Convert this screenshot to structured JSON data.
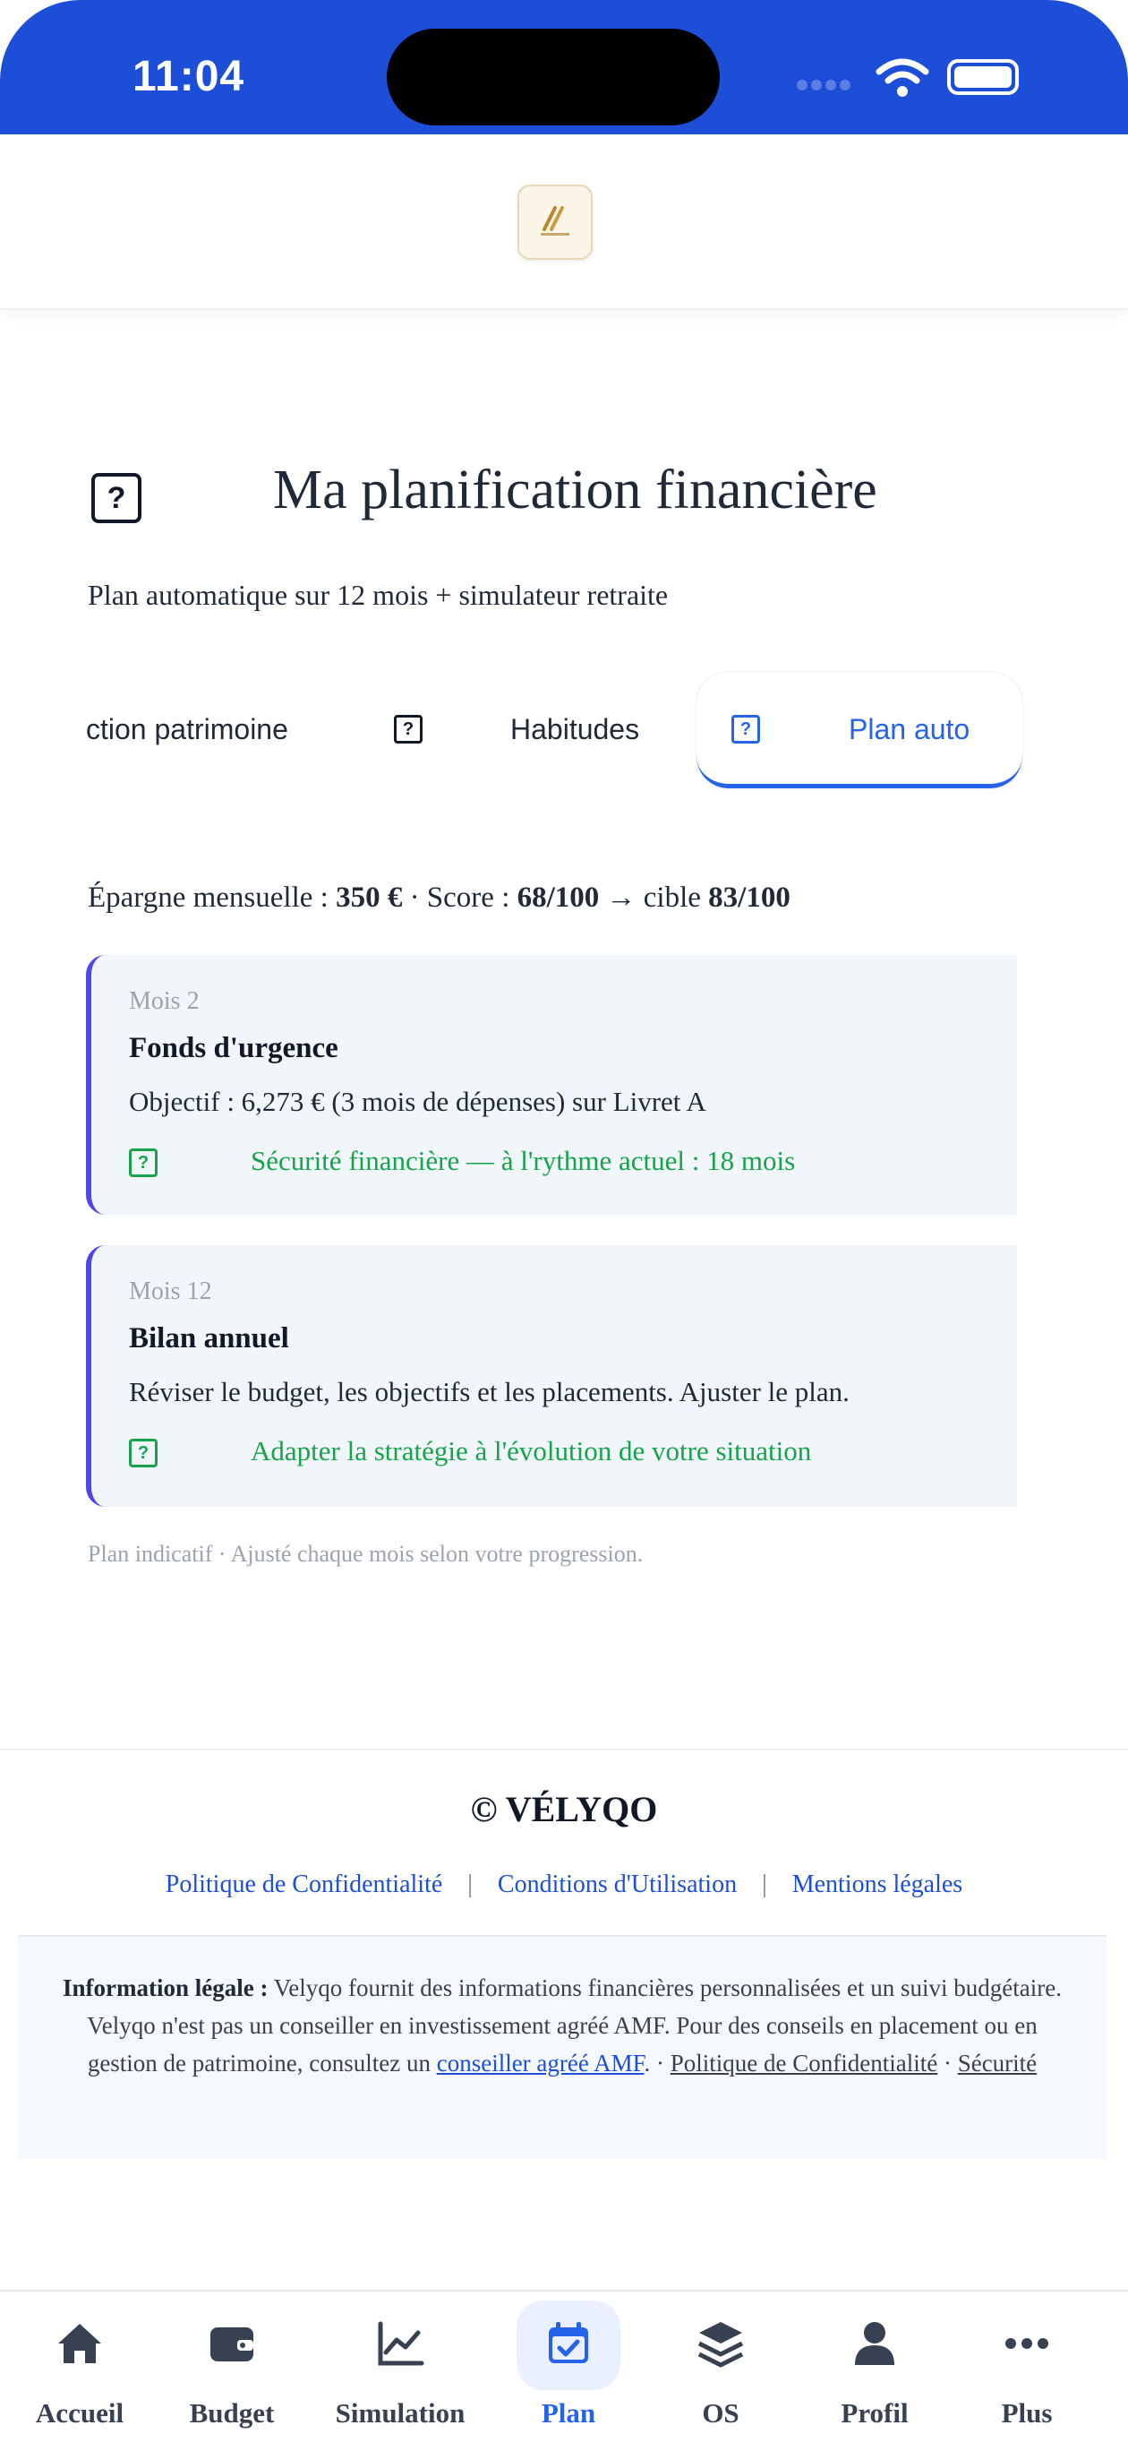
{
  "status": {
    "time": "11:04"
  },
  "page": {
    "title": "Ma planification financière",
    "subtitle": "Plan automatique sur 12 mois + simulateur retraite"
  },
  "tabs": [
    {
      "label": "ction patrimoine",
      "active": false
    },
    {
      "label": "Habitudes",
      "active": false
    },
    {
      "label": "Plan auto",
      "active": true
    }
  ],
  "summary": {
    "prefix": "Épargne mensuelle : ",
    "savings": "350 €",
    "score_prefix": " · Score : ",
    "score": "68/100",
    "target_prefix": " → cible ",
    "target": "83/100"
  },
  "plan": [
    {
      "month": "Mois 2",
      "title": "Fonds d'urgence",
      "description": "Objectif : 6,273 € (3 mois de dépenses) sur Livret A",
      "note": "Sécurité financière — à l'rythme actuel : 18 mois"
    },
    {
      "month": "Mois 12",
      "title": "Bilan annuel",
      "description": "Réviser le budget, les objectifs et les placements. Ajuster le plan.",
      "note": "Adapter la stratégie à l'évolution de votre situation"
    }
  ],
  "footnote": "Plan indicatif · Ajusté chaque mois selon votre progression.",
  "footer": {
    "brand": "© VÉLYQO",
    "links": [
      "Politique de Confidentialité",
      "Conditions d'Utilisation",
      "Mentions légales"
    ],
    "separator": "|",
    "legal_label": "Information légale :",
    "legal_text_1": " Velyqo fournit des informations financières personnalisées et un suivi budgétaire. Velyqo n'est pas un conseiller en investissement agréé AMF. Pour des conseils en placement ou en gestion de patrimoine, consultez un ",
    "legal_link_1": "conseiller agréé AMF",
    "legal_dot": ". · ",
    "legal_link_2": "Politique de Confidentialité",
    "legal_dot2": " · ",
    "legal_link_3": "Sécurité"
  },
  "nav": [
    {
      "label": "Accueil",
      "icon": "home-icon"
    },
    {
      "label": "Budget",
      "icon": "wallet-icon"
    },
    {
      "label": "Simulation",
      "icon": "chart-line-icon"
    },
    {
      "label": "Plan",
      "icon": "calendar-check-icon",
      "active": true
    },
    {
      "label": "OS",
      "icon": "layers-icon"
    },
    {
      "label": "Profil",
      "icon": "user-icon"
    },
    {
      "label": "Plus",
      "icon": "more-icon"
    }
  ],
  "colors": {
    "primary": "#1d4ed8",
    "accent": "#4f46e5",
    "success": "#16a34a"
  }
}
